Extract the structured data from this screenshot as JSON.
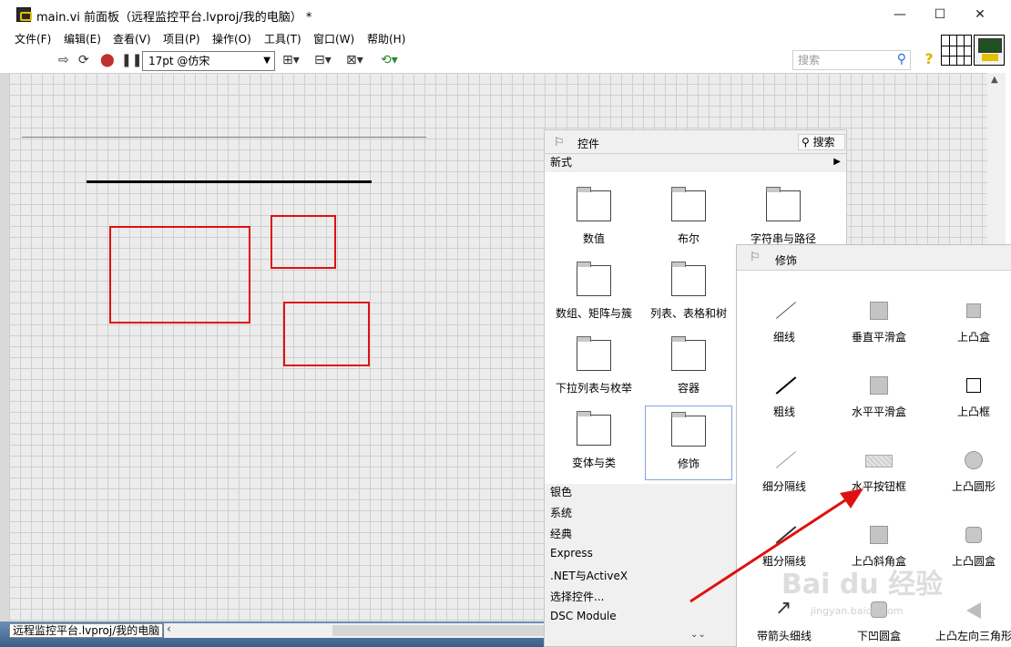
{
  "window": {
    "title": "main.vi 前面板（远程监控平台.lvproj/我的电脑） *",
    "controls": [
      "—",
      "☐",
      "✕"
    ]
  },
  "menu": [
    "文件(F)",
    "编辑(E)",
    "查看(V)",
    "项目(P)",
    "操作(O)",
    "工具(T)",
    "窗口(W)",
    "帮助(H)"
  ],
  "toolbar": {
    "font_value": "17pt @仿宋",
    "search_placeholder": "搜索",
    "help_symbol": "?"
  },
  "status": {
    "context": "远程监控平台.lvproj/我的电脑"
  },
  "controls_palette": {
    "title": "控件",
    "search_label": "搜索",
    "category": "新式",
    "items": [
      "数值",
      "布尔",
      "字符串与路径",
      "数组、矩阵与簇",
      "列表、表格和树",
      "下拉列表与枚举",
      "容器",
      "变体与类",
      "修饰"
    ],
    "selected": "修饰",
    "other_categories": [
      "银色",
      "系统",
      "经典",
      "Express",
      ".NET与ActiveX",
      "选择控件...",
      "DSC Module"
    ]
  },
  "decorations_palette": {
    "title": "修饰",
    "items": [
      "细线",
      "垂直平滑盒",
      "上凸盒",
      "粗线",
      "水平平滑盒",
      "上凸框",
      "细分隔线",
      "水平按钮框",
      "上凸圆形",
      "粗分隔线",
      "上凸斜角盒",
      "上凸圆盒",
      "带箭头细线",
      "下凹圆盒",
      "上凸左向三角形"
    ]
  },
  "watermark": {
    "brand": "Bai du 经验",
    "url": "jingyan.baidu.com"
  },
  "colors": {
    "annotation_red": "#e01010",
    "canvas_bg": "#ececec",
    "grid_line": "#cfcfcf"
  }
}
